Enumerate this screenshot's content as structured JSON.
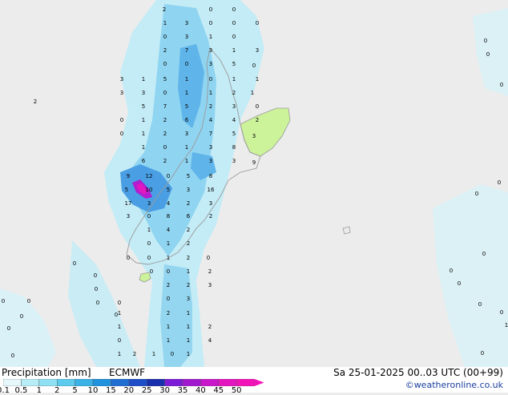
{
  "footer": {
    "title": "Precipitation [mm]",
    "model": "ECMWF",
    "valid_time": "Sa 25-01-2025 00..03 UTC (00+99)",
    "credit": "©weatheronline.co.uk"
  },
  "scale": {
    "ticks": [
      "0.1",
      "0.5",
      "1",
      "2",
      "5",
      "10",
      "15",
      "20",
      "25",
      "30",
      "35",
      "40",
      "45",
      "50"
    ],
    "colors": [
      "#e6f8fb",
      "#b7edf7",
      "#8fe0f2",
      "#5ccbed",
      "#3ab2e6",
      "#2192dd",
      "#1f6fd3",
      "#1d4ec8",
      "#1a2fab",
      "#7d1cd6",
      "#a11ad0",
      "#c918c9",
      "#e316c0",
      "#f213b8"
    ]
  },
  "map": {
    "colors": {
      "sea": "#ececec",
      "land_dry": "#ccf29a",
      "light_precip": "#c2ecf7",
      "mid_precip": "#8fd4f0",
      "heavy_precip": "#4a9ee3",
      "max_precip": "#b01ed0",
      "coastline": "#9a9a9a"
    },
    "point_values": [
      "2",
      "0",
      "0",
      "1",
      "3",
      "0",
      "0",
      "0",
      "0",
      "3",
      "1",
      "0",
      "2",
      "7",
      "3",
      "1",
      "3",
      "0",
      "0",
      "3",
      "5",
      "0",
      "3",
      "1",
      "5",
      "1",
      "0",
      "1",
      "1",
      "3",
      "3",
      "0",
      "1",
      "1",
      "2",
      "1",
      "5",
      "7",
      "5",
      "2",
      "3",
      "0",
      "0",
      "1",
      "2",
      "6",
      "4",
      "4",
      "2",
      "0",
      "1",
      "2",
      "3",
      "7",
      "5",
      "3",
      "1",
      "0",
      "1",
      "3",
      "8",
      "6",
      "2",
      "1",
      "3",
      "3",
      "9",
      "9",
      "12",
      "0",
      "5",
      "8",
      "5",
      "10",
      "5",
      "3",
      "16",
      "17",
      "3",
      "4",
      "2",
      "3",
      "3",
      "0",
      "8",
      "6",
      "2",
      "1",
      "4",
      "2",
      "0",
      "1",
      "2",
      "0",
      "0",
      "1",
      "2",
      "0",
      "0",
      "0",
      "1",
      "2",
      "2",
      "2",
      "3",
      "0",
      "3",
      "1",
      "2",
      "1",
      "1",
      "1",
      "1",
      "2",
      "1",
      "1",
      "4",
      "0",
      "1",
      "2",
      "1",
      "0",
      "1",
      "2",
      "0",
      "0",
      "0",
      "0",
      "0",
      "0",
      "0",
      "0",
      "0",
      "0",
      "0",
      "0",
      "0",
      "0",
      "0",
      "0",
      "0",
      "0",
      "0",
      "0",
      "1",
      "0",
      "0",
      "0",
      "0",
      "0",
      "0",
      "0"
    ]
  }
}
